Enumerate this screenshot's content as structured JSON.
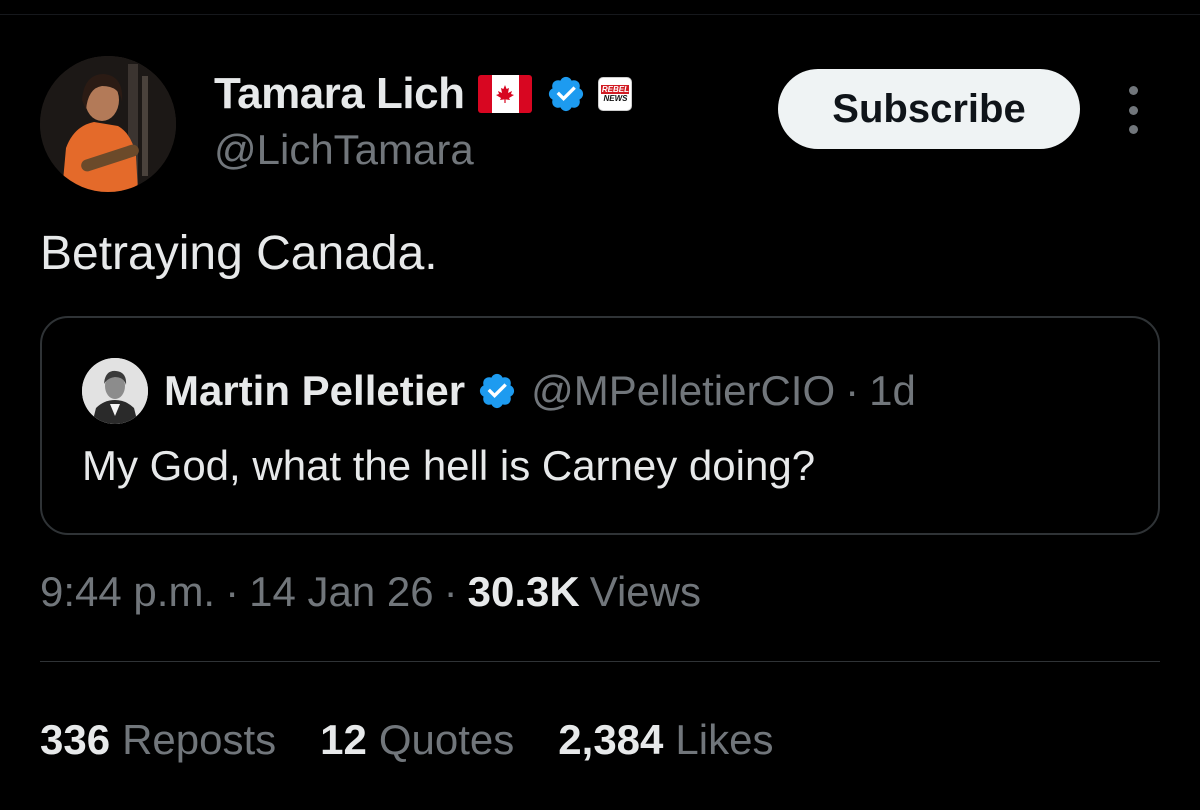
{
  "colors": {
    "background": "#000000",
    "text_primary": "#e7e9ea",
    "text_secondary": "#71767b",
    "verified_blue": "#1d9bf0",
    "border": "#2f3336",
    "button_bg": "#eff3f4",
    "canada_red": "#d80621",
    "affiliate_red": "#d21c24"
  },
  "author": {
    "display_name": "Tamara Lich",
    "handle": "@LichTamara",
    "flag_icon": "canada-flag-icon",
    "verified_icon": "verified-badge-icon",
    "affiliate_badge": {
      "icon": "rebel-news-affiliate-icon",
      "line1": "REBEL",
      "line2": "NEWS"
    }
  },
  "actions": {
    "subscribe_label": "Subscribe",
    "more_icon": "more-vertical-icon"
  },
  "tweet": {
    "text": "Betraying Canada."
  },
  "quote": {
    "display_name": "Martin Pelletier",
    "handle": "@MPelletierCIO",
    "separator": "·",
    "age": "1d",
    "verified_icon": "verified-badge-icon",
    "text": "My God, what the hell is Carney doing?"
  },
  "meta": {
    "time": "9:44 p.m.",
    "separator": "·",
    "date": "14 Jan 26",
    "views_count": "30.3K",
    "views_label": "Views"
  },
  "stats": {
    "reposts_count": "336",
    "reposts_label": "Reposts",
    "quotes_count": "12",
    "quotes_label": "Quotes",
    "likes_count": "2,384",
    "likes_label": "Likes"
  }
}
